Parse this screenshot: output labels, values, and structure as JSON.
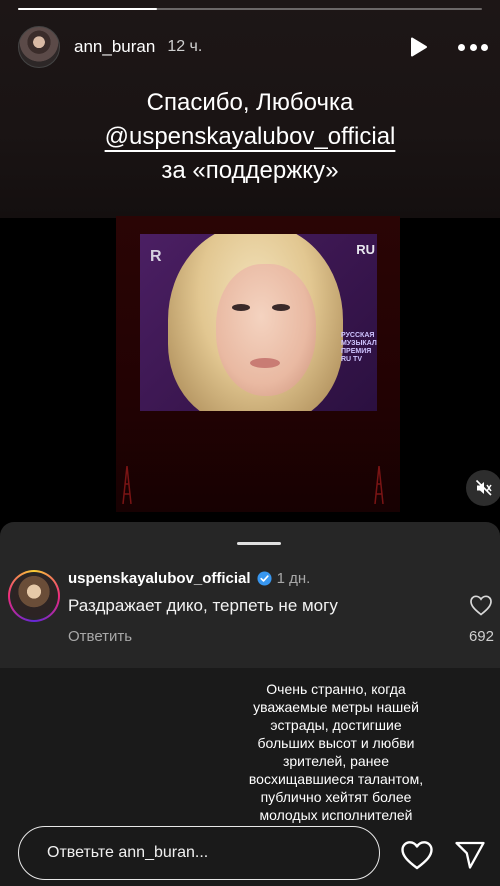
{
  "story": {
    "progress": 0.3,
    "username": "ann_buran",
    "time": "12 ч."
  },
  "caption": {
    "line1": "Спасибо, Любочка",
    "mention": "@uspenskayalubov_official",
    "line3": "за «поддержку»"
  },
  "video": {
    "logo": "RU",
    "logo_r": "R",
    "premium_text": "РУССКАЯ МУЗЫКАЛЬНАЯ ПРЕМИЯ RU TV"
  },
  "comment": {
    "username": "uspenskayalubov_official",
    "time": "1 дн.",
    "text": "Раздражает дико, терпеть не могу",
    "reply_label": "Ответить",
    "likes": "692"
  },
  "note": "Очень странно, когда уважаемые метры нашей эстрады, достигшие больших высот и любви зрителей, ранее восхищавшиеся талантом, публично хейтят более молодых исполнителей",
  "reply_bar": {
    "placeholder": "Ответьте ann_buran..."
  }
}
